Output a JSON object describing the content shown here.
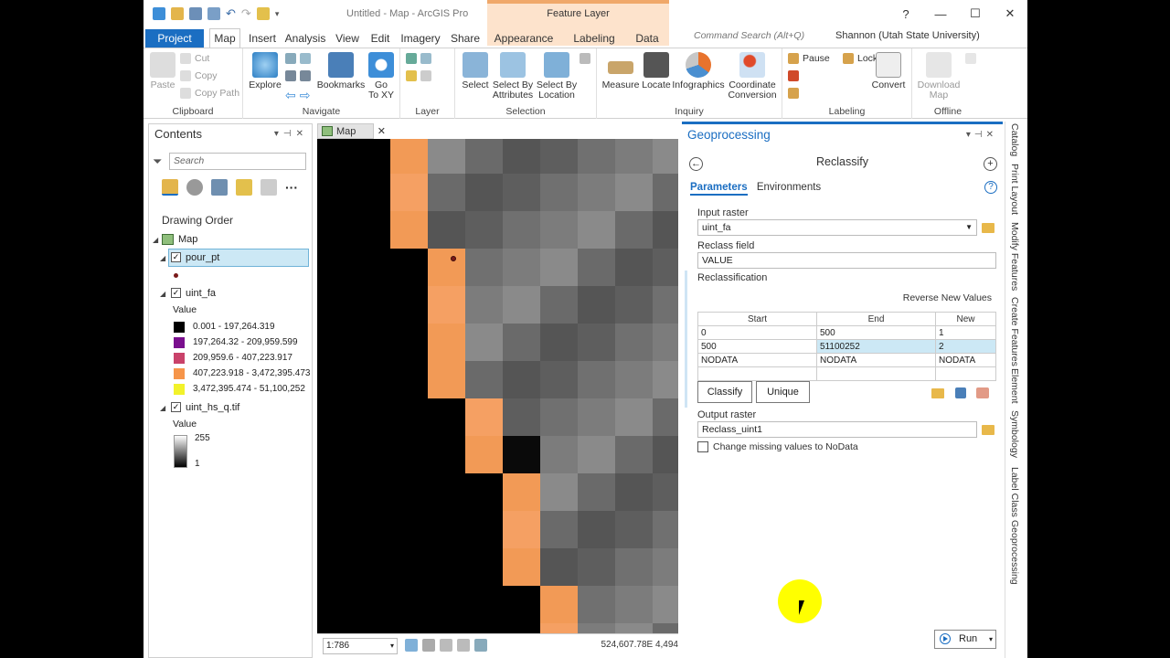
{
  "window": {
    "title": "Untitled - Map - ArcGIS Pro",
    "context_tab": "Feature Layer",
    "help": "?",
    "min": "—",
    "max": "☐",
    "close": "✕"
  },
  "tabs": [
    "Project",
    "Map",
    "Insert",
    "Analysis",
    "View",
    "Edit",
    "Imagery",
    "Share",
    "Appearance",
    "Labeling",
    "Data"
  ],
  "command_search": "Command Search (Alt+Q)",
  "user": "Shannon (Utah State University)",
  "ribbon": {
    "clipboard": {
      "label": "Clipboard",
      "paste": "Paste",
      "cut": "Cut",
      "copy": "Copy",
      "copy_path": "Copy Path"
    },
    "navigate": {
      "label": "Navigate",
      "explore": "Explore",
      "bookmarks": "Bookmarks",
      "goto_line1": "Go",
      "goto_line2": "To XY"
    },
    "layer": {
      "label": "Layer"
    },
    "selection": {
      "label": "Selection",
      "select": "Select",
      "sba_line1": "Select By",
      "sba_line2": "Attributes",
      "sbl_line1": "Select By",
      "sbl_line2": "Location"
    },
    "inquiry": {
      "label": "Inquiry",
      "measure": "Measure",
      "locate": "Locate",
      "infographics": "Infographics",
      "coord_line1": "Coordinate",
      "coord_line2": "Conversion"
    },
    "labeling": {
      "label": "Labeling",
      "pause": "Pause",
      "lock": "Lock",
      "convert": "Convert"
    },
    "offline": {
      "label": "Offline",
      "download_line1": "Download",
      "download_line2": "Map"
    }
  },
  "contents": {
    "title": "Contents",
    "search_placeholder": "Search",
    "drawing_order": "Drawing Order",
    "map_name": "Map",
    "layers": [
      {
        "name": "pour_pt"
      },
      {
        "name": "uint_fa",
        "legend_title": "Value",
        "classes": [
          {
            "label": "0.001 - 197,264.319",
            "color": "#000000"
          },
          {
            "label": "197,264.32 - 209,959.599",
            "color": "#7a0f8e"
          },
          {
            "label": "209,959.6 - 407,223.917",
            "color": "#c9426a"
          },
          {
            "label": "407,223.918 - 3,472,395.473",
            "color": "#f6954a"
          },
          {
            "label": "3,472,395.474 - 51,100,252",
            "color": "#f2f22a"
          }
        ]
      },
      {
        "name": "uint_hs_q.tif",
        "legend_title": "Value",
        "max": "255",
        "min": "1"
      }
    ]
  },
  "map": {
    "tab": "Map",
    "scale": "1:786",
    "coords": "524,607.78E 4,494"
  },
  "geoprocessing": {
    "title": "Geoprocessing",
    "tool": "Reclassify",
    "back_icon": "←",
    "add_icon": "+",
    "tab_params": "Parameters",
    "tab_env": "Environments",
    "input_raster_label": "Input raster",
    "input_raster": "uint_fa",
    "reclass_field_label": "Reclass field",
    "reclass_field": "VALUE",
    "reclassification_label": "Reclassification",
    "reverse": "Reverse New Values",
    "table_headers": [
      "Start",
      "End",
      "New"
    ],
    "rows": [
      [
        "0",
        "500",
        "1"
      ],
      [
        "500",
        "51100252",
        "2"
      ],
      [
        "NODATA",
        "NODATA",
        "NODATA"
      ],
      [
        "",
        "",
        ""
      ]
    ],
    "classify": "Classify",
    "unique": "Unique",
    "output_raster_label": "Output raster",
    "output_raster": "Reclass_uint1",
    "missing_nodata": "Change missing values to NoData",
    "run": "Run"
  },
  "side_tabs": [
    "Catalog",
    "Print Layout",
    "Modify Features",
    "Create Features",
    "Element",
    "Symbology",
    "Label Class",
    "Geoprocessing"
  ]
}
